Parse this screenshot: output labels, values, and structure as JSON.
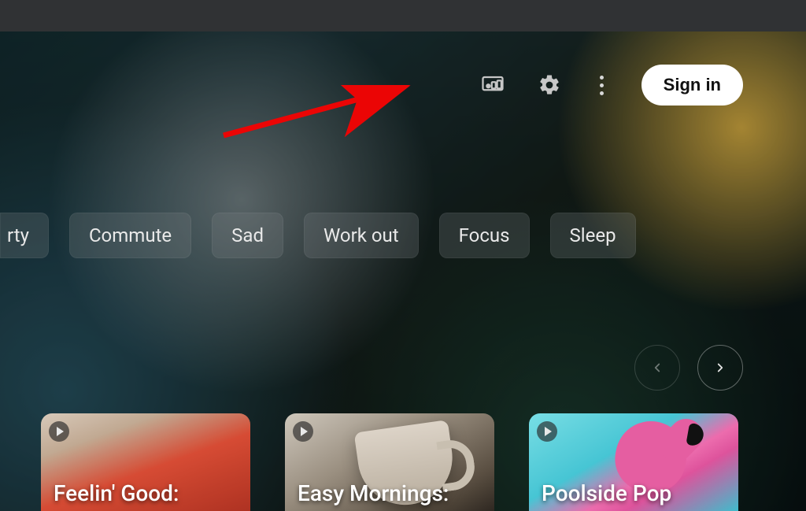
{
  "topbar": {
    "signin_label": "Sign in"
  },
  "chips": [
    {
      "label": "rty",
      "truncated": true
    },
    {
      "label": "Commute"
    },
    {
      "label": "Sad"
    },
    {
      "label": "Work out"
    },
    {
      "label": "Focus"
    },
    {
      "label": "Sleep"
    }
  ],
  "cards": [
    {
      "title": "Feelin' Good:"
    },
    {
      "title": "Easy Mornings:"
    },
    {
      "title": "Poolside Pop"
    }
  ],
  "colors": {
    "annotation_arrow": "#ff0000"
  }
}
